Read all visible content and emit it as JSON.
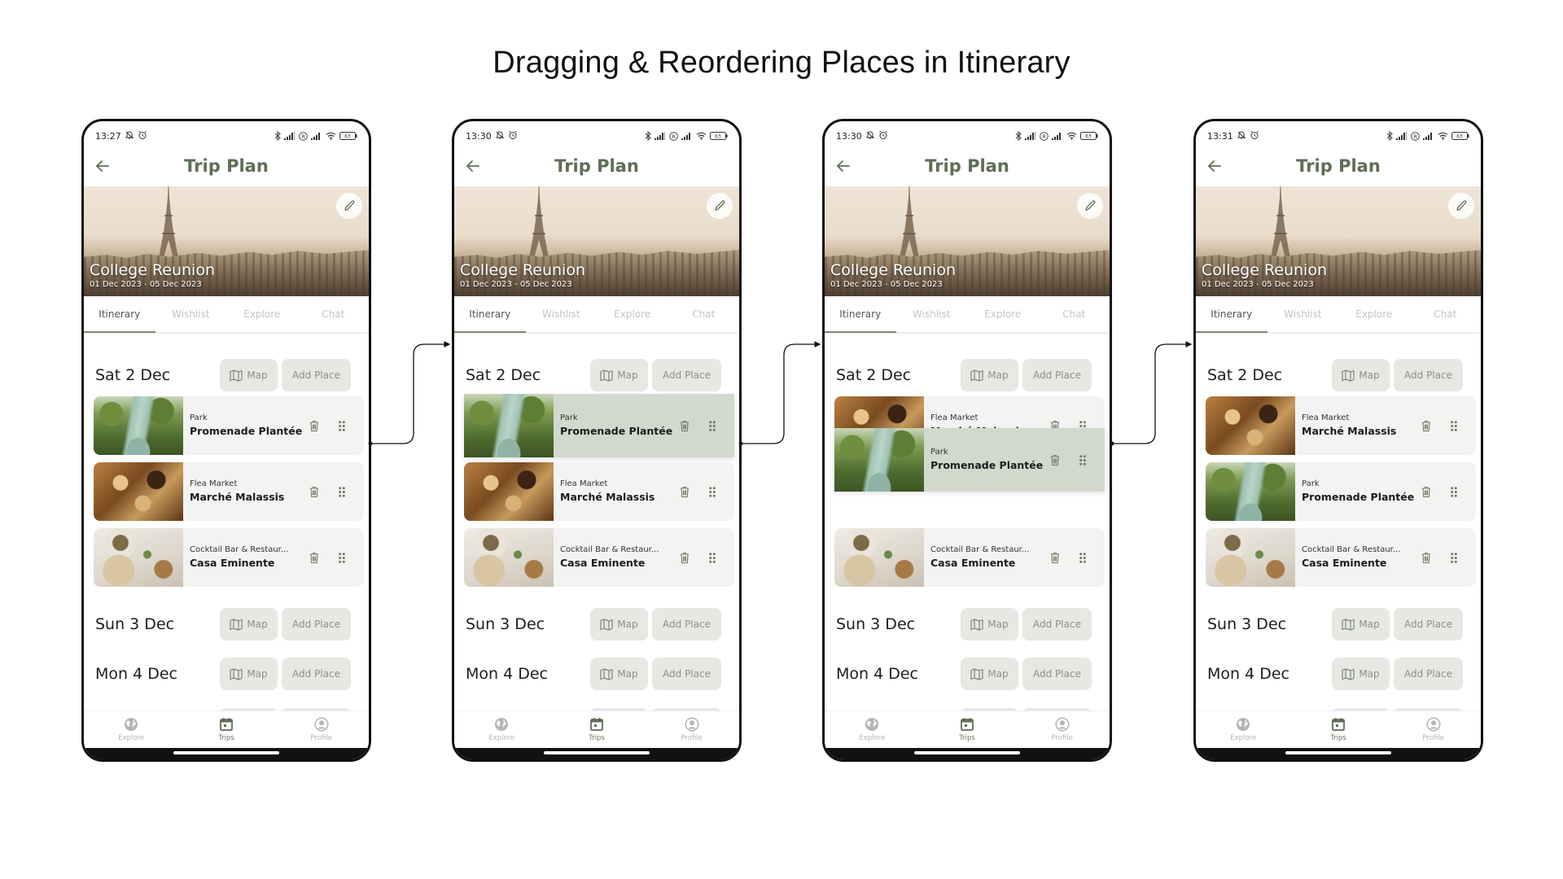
{
  "page": {
    "title": "Dragging & Reordering Places in Itinerary"
  },
  "colors": {
    "accent": "#5f6e55",
    "pill_bg": "#e6e8e3",
    "card_bg": "#f3f3f1",
    "dragging_bg": "#d1d9cc",
    "tab_inactive": "#c4c4c4"
  },
  "common": {
    "header_title": "Trip Plan",
    "trip_name": "College Reunion",
    "trip_dates": "01 Dec 2023 - 05 Dec 2023",
    "battery": "63",
    "tabs": [
      "Itinerary",
      "Wishlist",
      "Explore",
      "Chat"
    ],
    "map_label": "Map",
    "add_place_label": "Add Place",
    "days": [
      "Sat 2 Dec",
      "Sun 3 Dec",
      "Mon 4 Dec"
    ],
    "nav": [
      "Explore",
      "Trips",
      "Profile"
    ],
    "icons": {
      "back": "arrow-left-icon",
      "edit": "pencil-icon",
      "map": "map-icon",
      "delete": "trash-icon",
      "drag": "drag-handle-icon",
      "nav_explore": "globe-icon",
      "nav_trips": "calendar-icon",
      "nav_profile": "user-circle-icon"
    }
  },
  "places": {
    "park": {
      "category": "Park",
      "name": "Promenade Plantée"
    },
    "market": {
      "category": "Flea Market",
      "name": "Marché Malassis"
    },
    "food": {
      "category": "Cocktail Bar & Restaur...",
      "name": "Casa Eminente"
    }
  },
  "screens": [
    {
      "step": "1-initial",
      "time": "13:27",
      "order": [
        "park",
        "market",
        "food"
      ],
      "dragging": null
    },
    {
      "step": "2-pick-up",
      "time": "13:30",
      "order": [
        "park",
        "market",
        "food"
      ],
      "dragging": "park"
    },
    {
      "step": "3-dragging",
      "time": "13:30",
      "order": [
        "market",
        "park",
        "food"
      ],
      "dragging": "park"
    },
    {
      "step": "4-dropped",
      "time": "13:31",
      "order": [
        "market",
        "park",
        "food"
      ],
      "dragging": null
    }
  ],
  "s0": {
    "time": "13:27",
    "cards": [
      {
        "category": "Park",
        "name": "Promenade Plantée"
      },
      {
        "category": "Flea Market",
        "name": "Marché Malassis"
      },
      {
        "category": "Cocktail Bar & Restaur...",
        "name": "Casa Eminente"
      }
    ]
  },
  "s1": {
    "time": "13:30",
    "cards": [
      {
        "category": "Park",
        "name": "Promenade Plantée"
      },
      {
        "category": "Flea Market",
        "name": "Marché Malassis"
      },
      {
        "category": "Cocktail Bar & Restaur...",
        "name": "Casa Eminente"
      }
    ]
  },
  "s2": {
    "time": "13:30",
    "cards": [
      {
        "category": "Flea Market",
        "name": "Marché Malassis"
      },
      {
        "category": "Park",
        "name": "Promenade Plantée"
      },
      {
        "category": "Cocktail Bar & Restaur...",
        "name": "Casa Eminente"
      }
    ]
  },
  "s3": {
    "time": "13:31",
    "cards": [
      {
        "category": "Flea Market",
        "name": "Marché Malassis"
      },
      {
        "category": "Park",
        "name": "Promenade Plantée"
      },
      {
        "category": "Cocktail Bar & Restaur...",
        "name": "Casa Eminente"
      }
    ]
  }
}
